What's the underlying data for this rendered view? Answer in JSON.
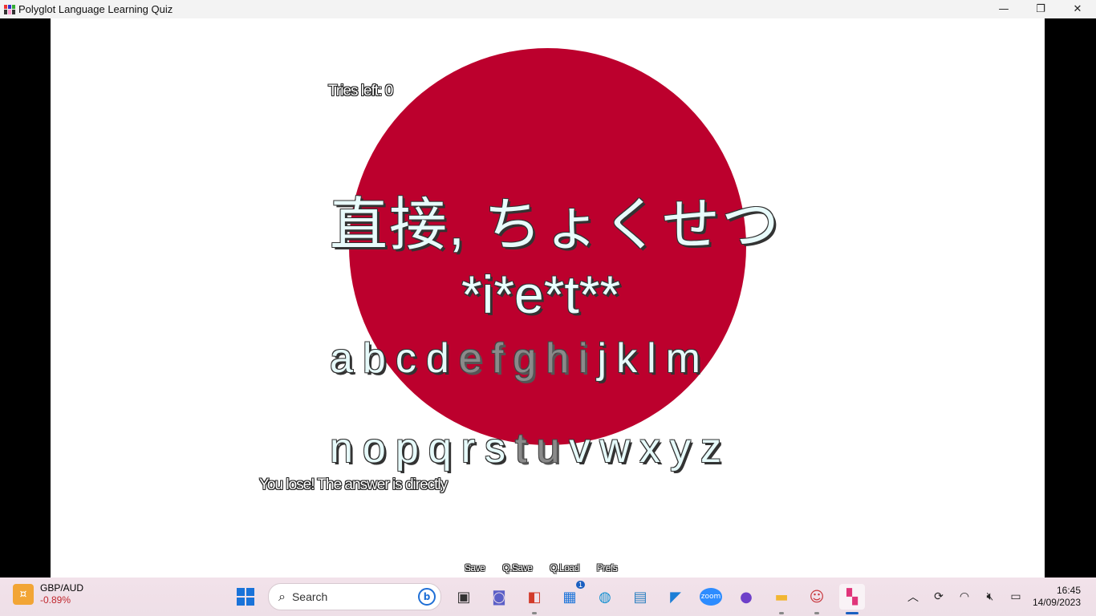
{
  "window": {
    "title": "Polyglot Language Learning Quiz",
    "minimize": "—",
    "restore": "❐",
    "close": "✕"
  },
  "game": {
    "tries": "Tries left: 0",
    "word_native": "直接, ちょくせつ",
    "masked_answer": "*i*e*t**",
    "result": "You lose! The answer is directly",
    "flag_color": "#bc002d",
    "letters_row1": [
      {
        "l": "a",
        "used": false
      },
      {
        "l": "b",
        "used": false
      },
      {
        "l": "c",
        "used": false
      },
      {
        "l": "d",
        "used": false
      },
      {
        "l": "e",
        "used": true
      },
      {
        "l": "f",
        "used": true
      },
      {
        "l": "g",
        "used": true
      },
      {
        "l": "h",
        "used": true
      },
      {
        "l": "i",
        "used": true
      },
      {
        "l": "j",
        "used": false
      },
      {
        "l": "k",
        "used": false
      },
      {
        "l": "l",
        "used": false
      },
      {
        "l": "m",
        "used": false
      }
    ],
    "letters_row2": [
      {
        "l": "n",
        "used": false
      },
      {
        "l": "o",
        "used": false
      },
      {
        "l": "p",
        "used": false
      },
      {
        "l": "q",
        "used": false
      },
      {
        "l": "r",
        "used": false
      },
      {
        "l": "s",
        "used": false
      },
      {
        "l": "t",
        "used": true
      },
      {
        "l": "u",
        "used": true
      },
      {
        "l": "v",
        "used": false
      },
      {
        "l": "w",
        "used": false
      },
      {
        "l": "x",
        "used": false
      },
      {
        "l": "y",
        "used": false
      },
      {
        "l": "z",
        "used": false
      }
    ],
    "quick_menu": [
      "Save",
      "Q.Save",
      "Q.Load",
      "Prefs"
    ]
  },
  "taskbar": {
    "widget": {
      "label": "GBP/AUD",
      "value": "-0.89%",
      "icon": "currency-icon"
    },
    "search_placeholder": "Search",
    "apps": [
      {
        "name": "task-view-icon",
        "glyph": "▣"
      },
      {
        "name": "teams-icon",
        "glyph": "◙"
      },
      {
        "name": "app-red-icon",
        "glyph": "◧"
      },
      {
        "name": "store-icon",
        "glyph": "▦",
        "badge": "1"
      },
      {
        "name": "edge-icon",
        "glyph": "◍"
      },
      {
        "name": "control-panel-icon",
        "glyph": "▤"
      },
      {
        "name": "vscode-icon",
        "glyph": "◤"
      },
      {
        "name": "zoom-icon",
        "glyph": "zoom"
      },
      {
        "name": "github-icon",
        "glyph": "●"
      },
      {
        "name": "file-explorer-icon",
        "glyph": "▬"
      },
      {
        "name": "game-app-icon",
        "glyph": "☺"
      },
      {
        "name": "polyglot-quiz-icon",
        "glyph": "▚"
      }
    ],
    "time": "16:45",
    "date": "14/09/2023"
  }
}
